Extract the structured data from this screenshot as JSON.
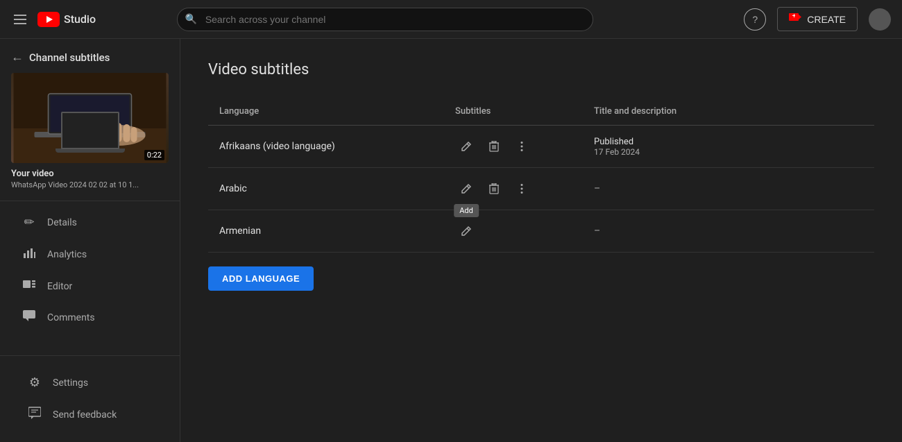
{
  "header": {
    "menu_label": "menu",
    "logo_text": "Studio",
    "search_placeholder": "Search across your channel",
    "help_label": "?",
    "create_label": "CREATE",
    "create_icon": "+"
  },
  "sidebar": {
    "back_label": "Channel subtitles",
    "video": {
      "title": "Your video",
      "filename": "WhatsApp Video 2024 02 02 at 10 1...",
      "duration": "0:22"
    },
    "nav_items": [
      {
        "id": "details",
        "label": "Details",
        "icon": "✏"
      },
      {
        "id": "analytics",
        "label": "Analytics",
        "icon": "📊"
      },
      {
        "id": "editor",
        "label": "Editor",
        "icon": "🎬"
      },
      {
        "id": "comments",
        "label": "Comments",
        "icon": "💬"
      }
    ],
    "bottom_items": [
      {
        "id": "settings",
        "label": "Settings",
        "icon": "⚙"
      },
      {
        "id": "send-feedback",
        "label": "Send feedback",
        "icon": "⚑"
      }
    ]
  },
  "main": {
    "page_title": "Video subtitles",
    "table": {
      "headers": {
        "language": "Language",
        "subtitles": "Subtitles",
        "title_desc": "Title and description"
      },
      "rows": [
        {
          "language": "Afrikaans (video language)",
          "has_edit": true,
          "has_delete": true,
          "has_more": true,
          "published": true,
          "published_label": "Published",
          "published_date": "17 Feb 2024",
          "title_desc": "Published"
        },
        {
          "language": "Arabic",
          "has_edit": true,
          "has_delete": true,
          "has_more": true,
          "published": false,
          "title_desc": "–"
        },
        {
          "language": "Armenian",
          "has_edit": true,
          "has_delete": false,
          "has_more": false,
          "published": false,
          "title_desc": "–",
          "show_add_tooltip": true,
          "add_tooltip": "Add"
        }
      ]
    },
    "add_language_label": "ADD LANGUAGE"
  }
}
